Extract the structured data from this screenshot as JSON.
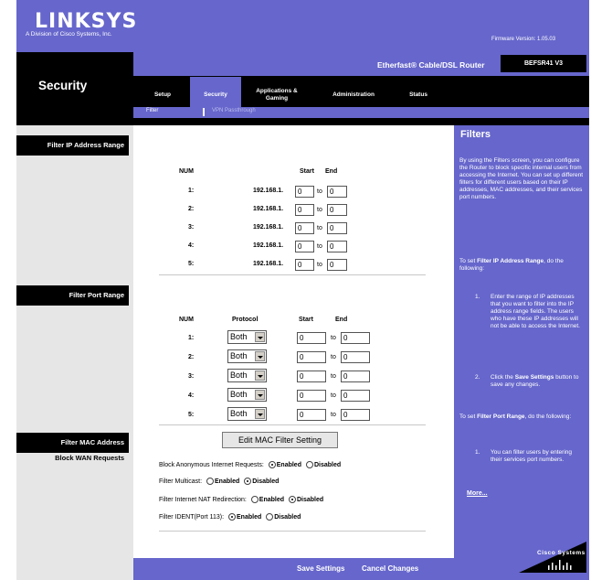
{
  "header": {
    "logo": "LINKSYS",
    "logo_tagline": "A Division of Cisco Systems, Inc.",
    "firmware": "Firmware Version: 1.05.03",
    "product_name": "Etherfast® Cable/DSL Router",
    "model": "BEFSR41 V3"
  },
  "section_title": "Security",
  "tabs": [
    {
      "label": "Setup"
    },
    {
      "label": "Security"
    },
    {
      "label": "Applications & Gaming"
    },
    {
      "label": "Administration"
    },
    {
      "label": "Status"
    }
  ],
  "subtabs": [
    {
      "label": "Filter"
    },
    {
      "label": "VPN Passthrough"
    }
  ],
  "left_labels": {
    "filter_ip": "Filter IP Address Range",
    "filter_port": "Filter Port Range",
    "filter_mac": "Filter MAC Address",
    "block_wan": "Block WAN Requests"
  },
  "ip_table": {
    "headers": {
      "num": "NUM",
      "start": "Start",
      "end": "End"
    },
    "prefix": "192.168.1.",
    "to": "to",
    "rows": [
      {
        "num": "1:",
        "start": "0",
        "end": "0"
      },
      {
        "num": "2:",
        "start": "0",
        "end": "0"
      },
      {
        "num": "3:",
        "start": "0",
        "end": "0"
      },
      {
        "num": "4:",
        "start": "0",
        "end": "0"
      },
      {
        "num": "5:",
        "start": "0",
        "end": "0"
      }
    ]
  },
  "port_table": {
    "headers": {
      "num": "NUM",
      "protocol": "Protocol",
      "start": "Start",
      "end": "End"
    },
    "to": "to",
    "rows": [
      {
        "num": "1:",
        "protocol": "Both",
        "start": "0",
        "end": "0"
      },
      {
        "num": "2:",
        "protocol": "Both",
        "start": "0",
        "end": "0"
      },
      {
        "num": "3:",
        "protocol": "Both",
        "start": "0",
        "end": "0"
      },
      {
        "num": "4:",
        "protocol": "Both",
        "start": "0",
        "end": "0"
      },
      {
        "num": "5:",
        "protocol": "Both",
        "start": "0",
        "end": "0"
      }
    ]
  },
  "edit_mac_button": "Edit MAC Filter Setting",
  "wan_options": [
    {
      "label": "Block Anonymous Internet Requests:",
      "enabled": "Enabled",
      "disabled": "Disabled",
      "selected": "enabled"
    },
    {
      "label": "Filter Multicast:",
      "enabled": "Enabled",
      "disabled": "Disabled",
      "selected": "disabled"
    },
    {
      "label": "Filter Internet NAT Redirection:",
      "enabled": "Enabled",
      "disabled": "Disabled",
      "selected": "disabled"
    },
    {
      "label": "Filter IDENT(Port 113):",
      "enabled": "Enabled",
      "disabled": "Disabled",
      "selected": "enabled"
    }
  ],
  "footer_buttons": {
    "save": "Save Settings",
    "cancel": "Cancel Changes"
  },
  "help": {
    "title": "Filters",
    "intro": "By using the Filters screen, you can configure the Router to block specific internal users from accessing the Internet. You can set up different filters for different users based on their IP addresses, MAC addresses, and their services port numbers.",
    "ip_heading_pre": "To set ",
    "ip_heading_bold": "Filter IP Address Range",
    "ip_heading_post": ", do the following:",
    "ip_step1": "Enter the range of IP addresses that you want to filter into the IP address range fields. The users who have these IP addresses will not be able to access the Internet.",
    "ip_step2_pre": "Click the ",
    "ip_step2_bold": "Save Settings",
    "ip_step2_post": " button to save any changes.",
    "port_heading_pre": "To set ",
    "port_heading_bold": "Filter Port Range",
    "port_heading_post": ", do the following:",
    "port_step1": "You can filter users by entering their services port numbers.",
    "more": "More...",
    "cisco": "Cisco Systems"
  },
  "colors": {
    "brand_purple": "#6666cc",
    "black": "#000000",
    "gray": "#e6e6e6"
  }
}
